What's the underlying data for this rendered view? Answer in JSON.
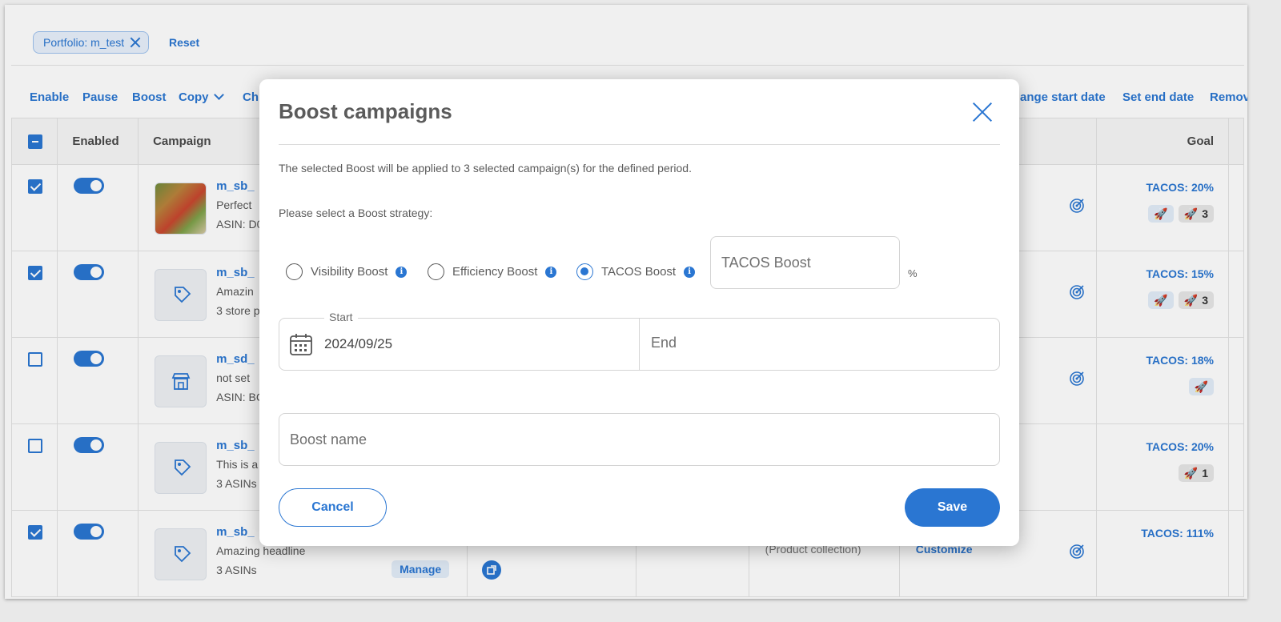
{
  "filters": {
    "chip_label": "Portfolio: m_test",
    "reset_label": "Reset"
  },
  "toolbar": {
    "enable": "Enable",
    "pause": "Pause",
    "boost": "Boost",
    "copy": "Copy",
    "change_partial": "Ch",
    "change_start_date_partial": "ange start date",
    "set_end_date": "Set end date",
    "remove_partial": "Remov"
  },
  "table": {
    "headers": {
      "enabled": "Enabled",
      "campaign": "Campaign",
      "goal": "Goal"
    },
    "rows": [
      {
        "checked": true,
        "name": "m_sb_",
        "line2": "Perfect",
        "line3": "ASIN: D0",
        "goal": "TACOS: 20%",
        "badge_count": "3"
      },
      {
        "checked": true,
        "name": "m_sb_",
        "line2": "Amazin",
        "line3": "3 store p",
        "goal": "TACOS: 15%",
        "badge_count": "3"
      },
      {
        "checked": false,
        "name": "m_sd_",
        "line2": "not set",
        "line3": "ASIN: BC",
        "goal": "TACOS: 18%"
      },
      {
        "checked": false,
        "name": "m_sb_",
        "line2": "This is a",
        "line3": "3 ASINs",
        "goal": "TACOS: 20%",
        "badge_count": "1"
      },
      {
        "checked": true,
        "name": "m_sb_",
        "line2": "Amazing headline",
        "line3": "3 ASINs",
        "manage": "Manage",
        "type": "(Product collection)",
        "customize": "Customize",
        "goal": "TACOS: 111%"
      }
    ]
  },
  "modal": {
    "title": "Boost campaigns",
    "description": "The selected Boost will be applied to 3 selected campaign(s) for the defined period.",
    "prompt": "Please select a Boost strategy:",
    "options": [
      "Visibility Boost",
      "Efficiency Boost",
      "TACOS Boost"
    ],
    "selected_option": "TACOS Boost",
    "tacos_placeholder": "TACOS Boost",
    "percent": "%",
    "start_label": "Start",
    "start_value": "2024/09/25",
    "end_placeholder": "End",
    "name_placeholder": "Boost name",
    "cancel": "Cancel",
    "save": "Save"
  },
  "colors": {
    "accent": "#2a76d2",
    "text": "#5b5b5b"
  }
}
